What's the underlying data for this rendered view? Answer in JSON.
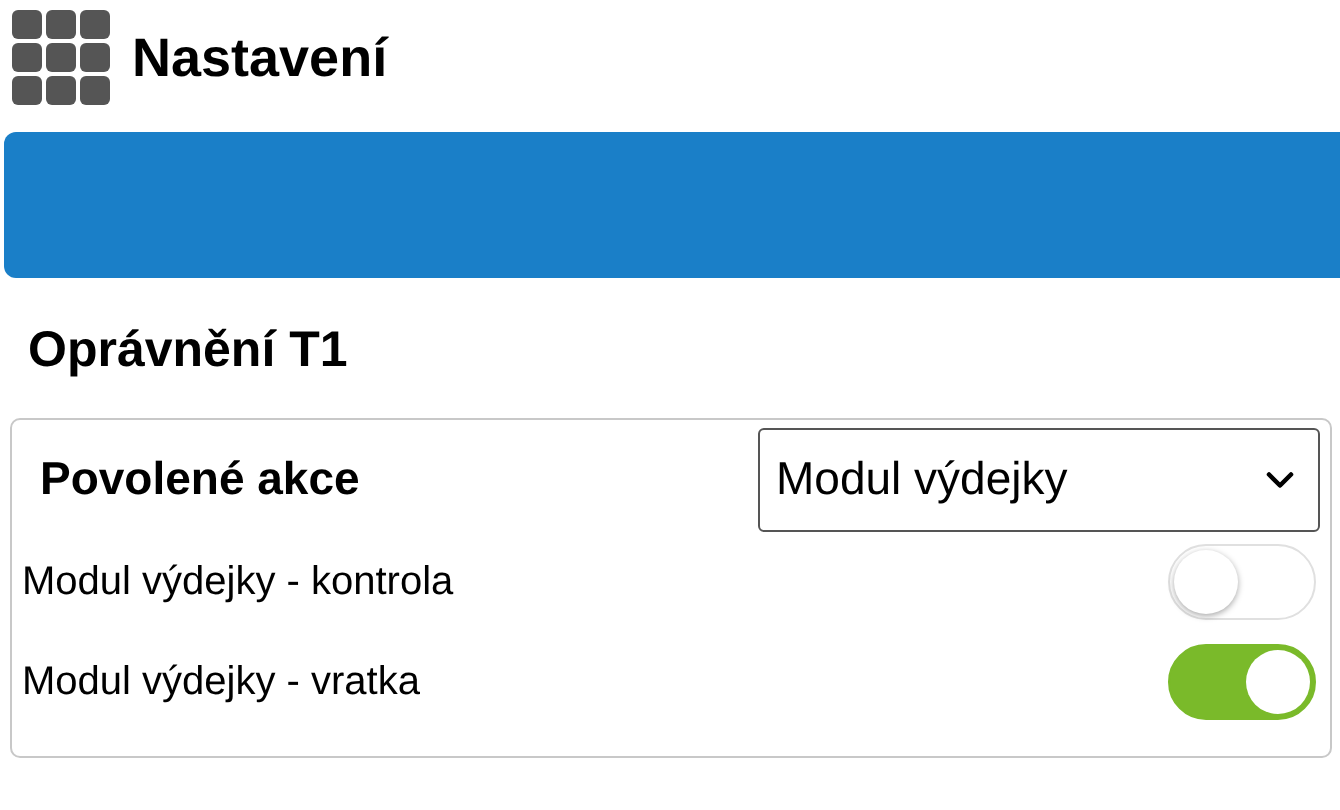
{
  "header": {
    "title": "Nastavení"
  },
  "section_title": "Oprávnění T1",
  "permissions": {
    "label": "Povolené akce",
    "select": {
      "value": "Modul výdejky"
    },
    "toggles": [
      {
        "label": "Modul výdejky - kontrola",
        "on": false
      },
      {
        "label": "Modul výdejky - vratka",
        "on": true
      }
    ]
  }
}
